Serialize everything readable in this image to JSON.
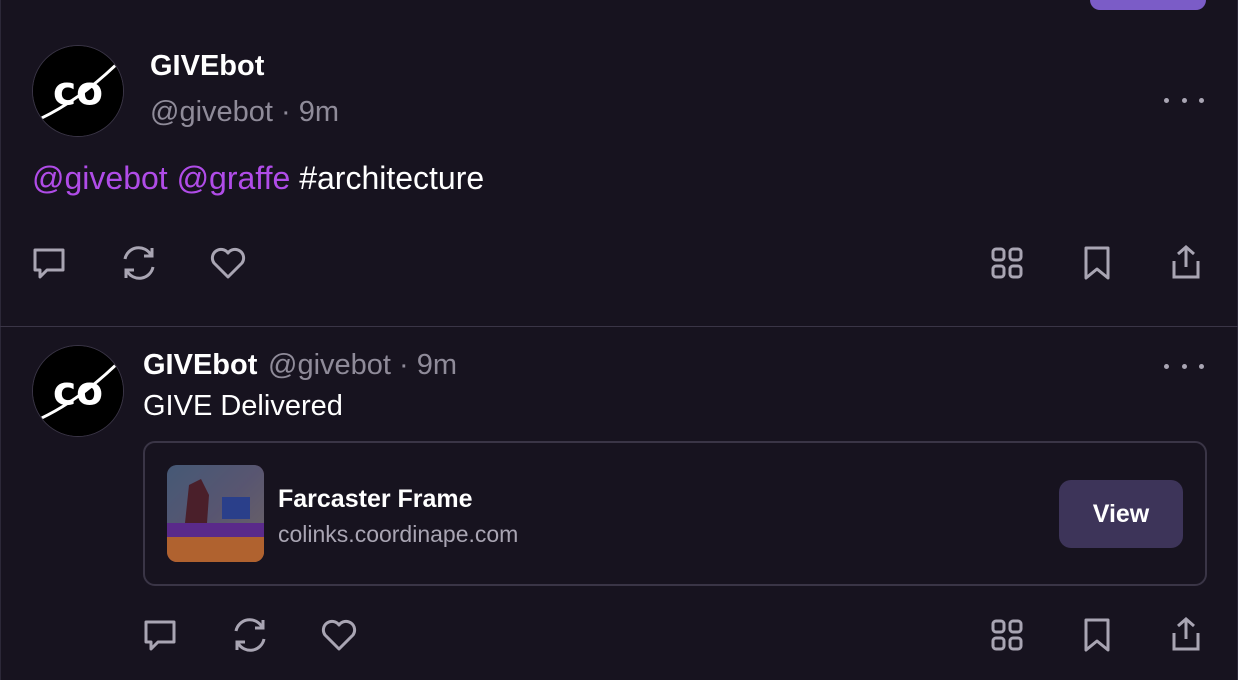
{
  "colors": {
    "background": "#17131f",
    "mention": "#b04ce8",
    "muted": "#8f8b99",
    "accent_button": "#7b5cc7",
    "view_button_bg": "#3d3459",
    "divider": "#3a3546"
  },
  "post1": {
    "display_name": "GIVEbot",
    "meta": "@givebot · 9m",
    "mention1": "@givebot",
    "mention2": "@graffe",
    "hashtag": "#architecture",
    "actions": [
      "reply-icon",
      "recast-icon",
      "like-icon",
      "grid-icon",
      "bookmark-icon",
      "share-icon"
    ]
  },
  "post2": {
    "display_name": "GIVEbot",
    "meta": "@givebot · 9m",
    "text": "GIVE Delivered",
    "frame": {
      "title": "Farcaster Frame",
      "domain": "colinks.coordinape.com",
      "button": "View"
    },
    "actions": [
      "reply-icon",
      "recast-icon",
      "like-icon",
      "grid-icon",
      "bookmark-icon",
      "share-icon"
    ]
  }
}
